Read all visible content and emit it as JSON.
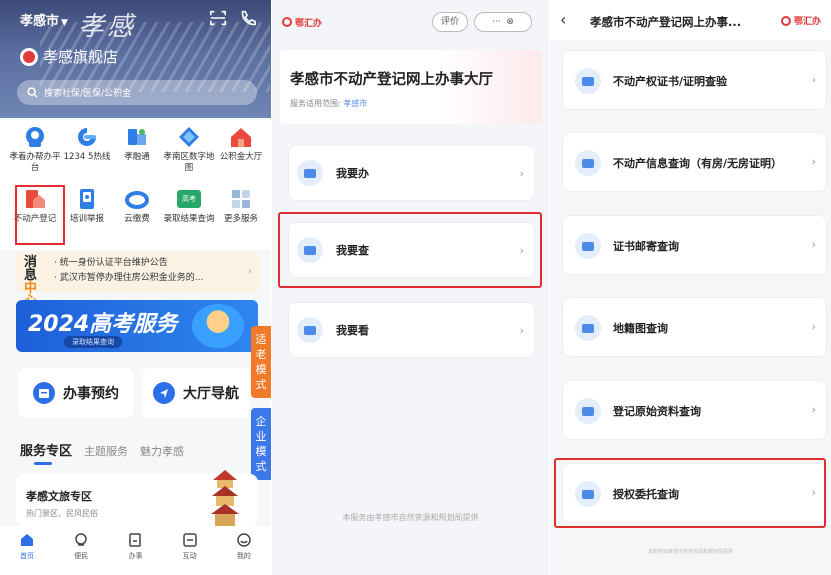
{
  "colors": {
    "accent": "#2d6fe6",
    "highlight": "#e02f2f",
    "brand_red": "#e23b3b",
    "notice_bg": "#fbf2e4",
    "orange": "#f07a2a"
  },
  "panel1": {
    "city": "孝感市",
    "header_icons": [
      "scan-icon",
      "phone-icon"
    ],
    "store_name": "孝感旗舰店",
    "search_placeholder": "搜索社保/医保/公积金",
    "grid": [
      {
        "icon": "xiaozhuban-icon",
        "label": "孝着办帮办平台"
      },
      {
        "icon": "hotline-icon",
        "label": "1234 5热线"
      },
      {
        "icon": "xiaorongtong-icon",
        "label": "孝融通"
      },
      {
        "icon": "digital-map-icon",
        "label": "孝南区数字地图"
      },
      {
        "icon": "housing-fund-icon",
        "label": "公积金大厅"
      },
      {
        "icon": "real-estate-icon",
        "label": "不动产登记"
      },
      {
        "icon": "training-report-icon",
        "label": "培训举报"
      },
      {
        "icon": "cloud-pay-icon",
        "label": "云缴费"
      },
      {
        "icon": "gaokao-icon",
        "label": "录取结果查询"
      },
      {
        "icon": "more-services-icon",
        "label": "更多服务"
      }
    ],
    "gaokao_badge": "高考",
    "notice": {
      "logo_top": "消息",
      "logo_bottom": "中心",
      "lines": [
        "· 统一身份认证平台维护公告",
        "· 武汉市暂停办理住房公积金业务的..."
      ]
    },
    "banner": {
      "title": "2024高考服务",
      "sub": "录取结果查询"
    },
    "side_badge_1": "适老模式",
    "side_badge_2": "企业模式",
    "btn_appointment": "办事预约",
    "btn_navigation": "大厅导航",
    "tabs": [
      "服务专区",
      "主题服务",
      "魅力孝感"
    ],
    "card": {
      "title": "孝感文旅专区",
      "sub": "热门景区、民风民俗"
    },
    "bottom_nav": [
      "首页",
      "便民",
      "办事",
      "互动",
      "我的"
    ]
  },
  "panel2": {
    "brand": "鄂汇办",
    "rate_label": "评价",
    "more_label": "···",
    "close_label": "⊗",
    "title": "孝感市不动产登记网上办事大厅",
    "scope_label": "服务适用范围:",
    "scope_value": "孝感市",
    "items": [
      "我要办",
      "我要查",
      "我要看"
    ],
    "footer": "本服务由孝感市自然资源和规划局提供"
  },
  "panel3": {
    "back": "‹",
    "title": "孝感市不动产登记网上办事...",
    "brand": "鄂汇办",
    "items": [
      "不动产权证书/证明查验",
      "不动产信息查询（有房/无房证明）",
      "证书邮寄查询",
      "地籍图查询",
      "登记原始资料查询",
      "授权委托查询"
    ],
    "footer": "本服务由孝感市自然资源和规划局提供"
  }
}
